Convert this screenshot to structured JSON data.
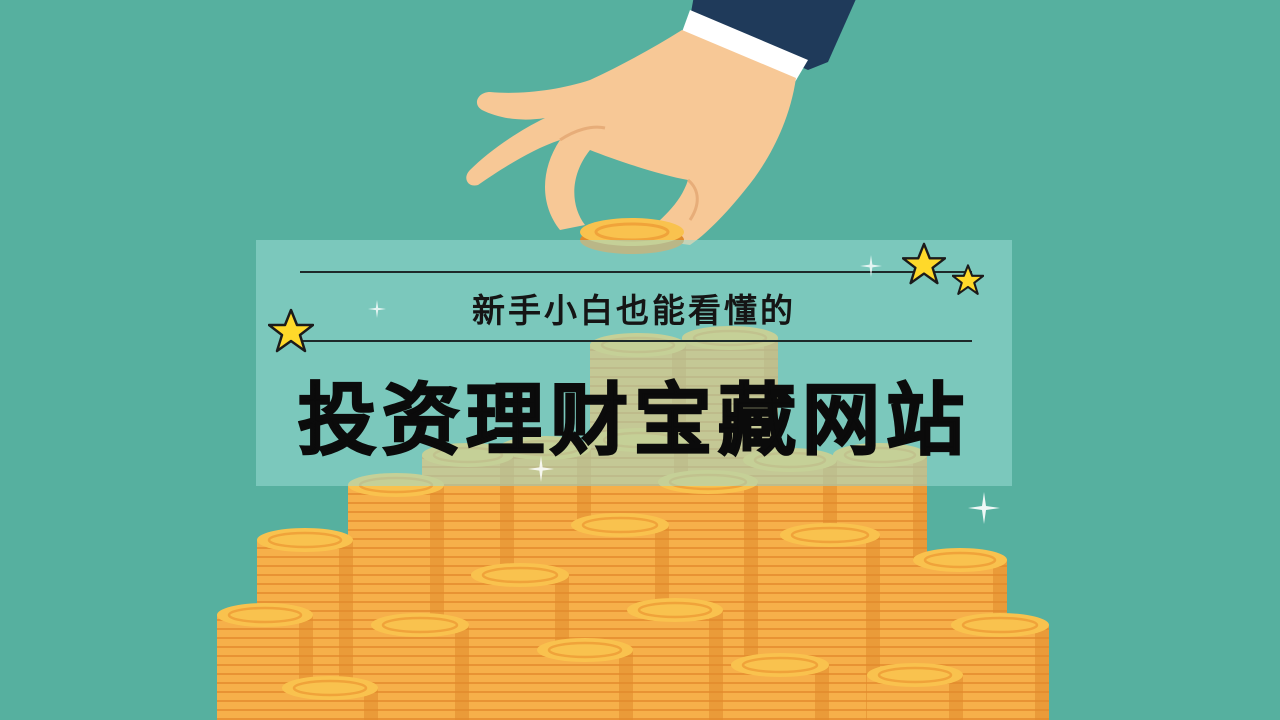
{
  "banner": {
    "subtitle": "新手小白也能看懂的",
    "title": "投资理财宝藏网站"
  },
  "colors": {
    "background": "#56b09f",
    "coin_face": "#f9c24e",
    "coin_edge": "#f0a33a",
    "coin_shadow": "#e08a2c",
    "skin": "#f7c896",
    "sleeve": "#1f3a5a",
    "star": "#ffd92a",
    "title_text": "#0b0b0b"
  },
  "icons": [
    "star-icon",
    "sparkle-icon",
    "coin-icon",
    "hand-icon"
  ]
}
